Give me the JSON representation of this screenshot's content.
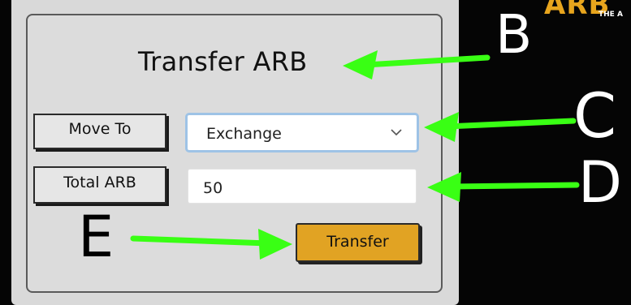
{
  "dialog": {
    "title": "Transfer ARB",
    "move_to_label": "Move To",
    "total_label": "Total ARB",
    "move_to_select": {
      "selected": "Exchange"
    },
    "total_input": {
      "value": "50"
    },
    "transfer_button_label": "Transfer"
  },
  "annotations": {
    "b": "B",
    "c": "C",
    "d": "D",
    "e": "E"
  },
  "logo": {
    "text": "ARB",
    "subtext": "THE A"
  },
  "colors": {
    "background": "#050505",
    "panel": "#dcdcdc",
    "accent_button": "#e1a323",
    "arrow": "#39ff14",
    "select_focus_border": "#9ec3e6",
    "logo": "#e8a51d"
  },
  "icons": {
    "select_chevron": "chevron-down-icon"
  }
}
